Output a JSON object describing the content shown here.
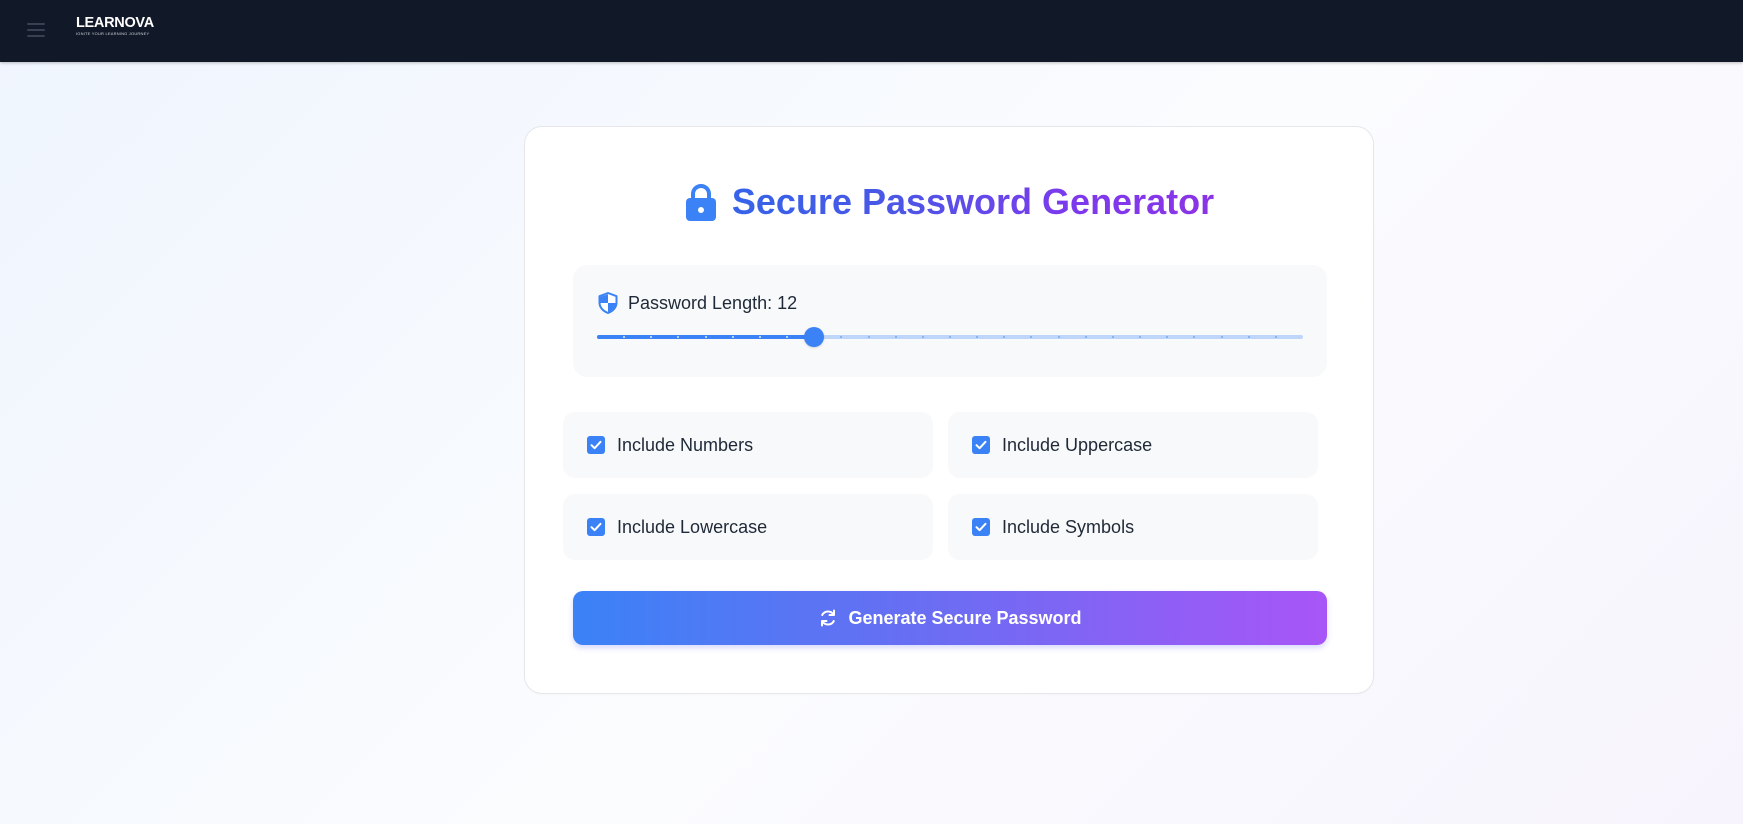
{
  "header": {
    "menu_icon": "hamburger-menu-icon",
    "logo_text": "LEARNOVA",
    "logo_tagline": "IGNITE YOUR LEARNING JOURNEY"
  },
  "generator": {
    "title": "Secure Password Generator",
    "title_icon": "lock-icon",
    "length": {
      "icon": "shield-icon",
      "label_prefix": "Password Length: ",
      "value": "12",
      "min": 4,
      "max": 30
    },
    "options": [
      {
        "label": "Include Numbers",
        "checked": true
      },
      {
        "label": "Include Uppercase",
        "checked": true
      },
      {
        "label": "Include Lowercase",
        "checked": true
      },
      {
        "label": "Include Symbols",
        "checked": true
      }
    ],
    "button": {
      "icon": "refresh-icon",
      "label": "Generate Secure Password"
    }
  },
  "colors": {
    "topbar": "#111827",
    "accent_blue": "#3b82f6",
    "accent_purple": "#a855f7",
    "title_gradient_start": "#3563e9",
    "title_gradient_end": "#8b34e6"
  }
}
